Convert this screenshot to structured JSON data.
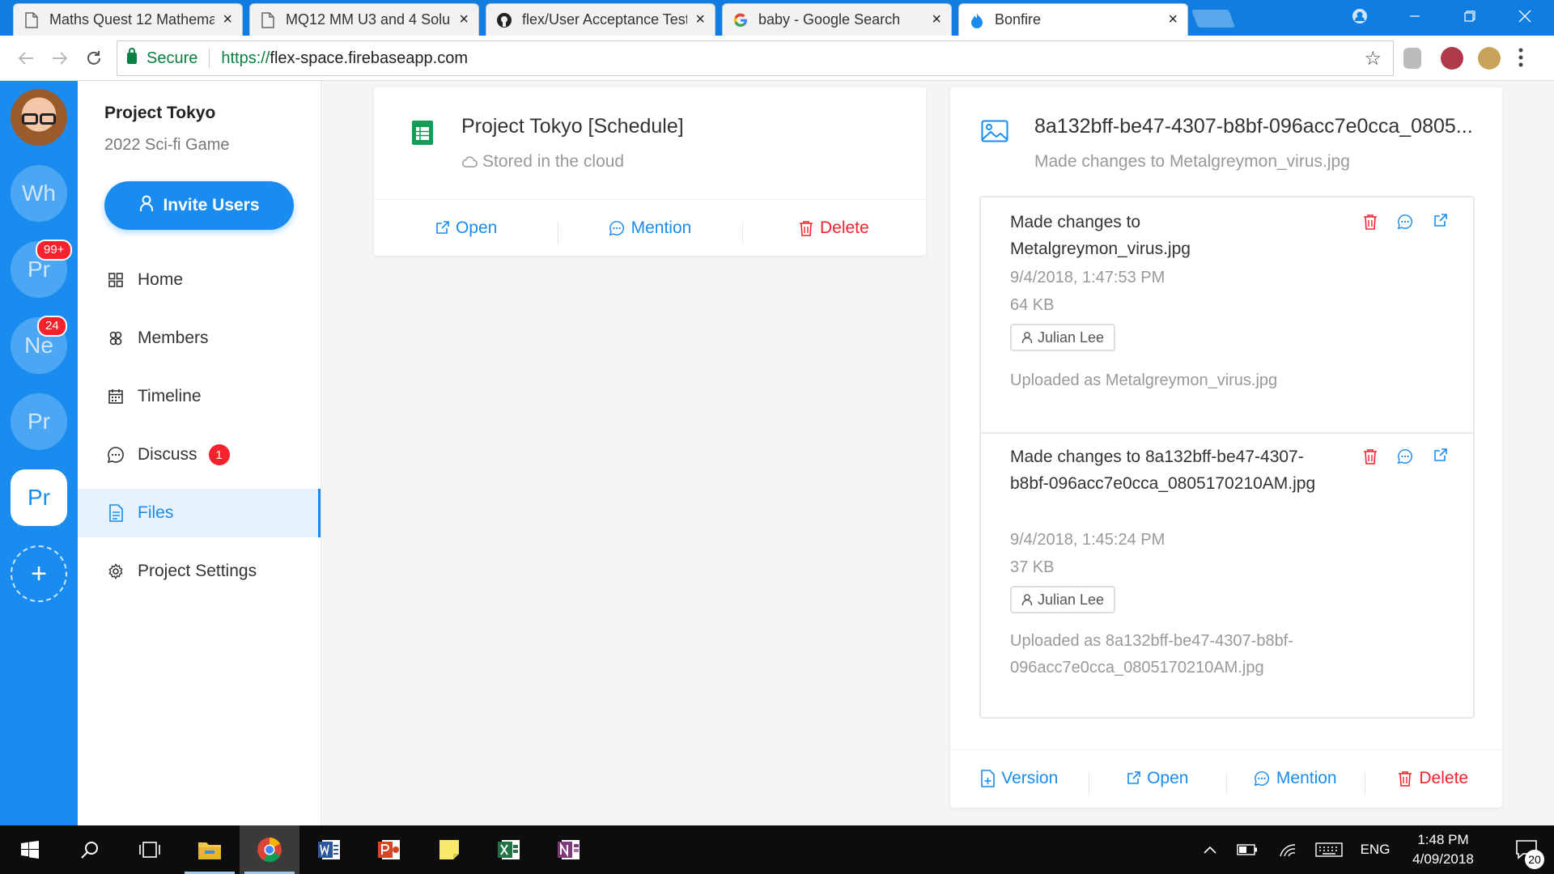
{
  "browser": {
    "tabs": [
      {
        "title": "Maths Quest 12 Mathema",
        "icon": "document-icon"
      },
      {
        "title": "MQ12 MM U3 and 4 Solu",
        "icon": "document-icon"
      },
      {
        "title": "flex/User Acceptance Test",
        "icon": "github-icon"
      },
      {
        "title": "baby - Google Search",
        "icon": "google-icon"
      },
      {
        "title": "Bonfire",
        "icon": "bonfire-icon"
      }
    ],
    "close_glyph": "×",
    "secure_label": "Secure",
    "url_scheme": "https://",
    "url_host": "flex-space.firebaseapp.com"
  },
  "strip": {
    "projects": [
      {
        "label": "Wh",
        "badge": ""
      },
      {
        "label": "Pr",
        "badge": "99+"
      },
      {
        "label": "Ne",
        "badge": "24"
      },
      {
        "label": "Pr",
        "badge": ""
      },
      {
        "label": "Pr",
        "badge": ""
      }
    ],
    "add_label": "+"
  },
  "nav": {
    "project_name": "Project Tokyo",
    "project_desc": "2022 Sci-fi Game",
    "invite_label": "Invite Users",
    "items": [
      {
        "label": "Home",
        "icon": "grid-icon"
      },
      {
        "label": "Members",
        "icon": "members-icon"
      },
      {
        "label": "Timeline",
        "icon": "calendar-icon"
      },
      {
        "label": "Discuss",
        "icon": "chat-icon",
        "badge": "1"
      },
      {
        "label": "Files",
        "icon": "file-icon"
      },
      {
        "label": "Project Settings",
        "icon": "gear-icon"
      }
    ]
  },
  "left_card": {
    "title": "Project Tokyo [Schedule]",
    "subtitle": "Stored in the cloud",
    "actions": {
      "open": "Open",
      "mention": "Mention",
      "delete": "Delete"
    }
  },
  "right_card": {
    "title": "8a132bff-be47-4307-b8bf-096acc7e0cca_0805...",
    "subtitle": "Made changes to Metalgreymon_virus.jpg",
    "history": [
      {
        "heading": "Made changes to Metalgreymon_virus.jpg",
        "date": "9/4/2018, 1:47:53 PM",
        "size": "64 KB",
        "user": "Julian Lee",
        "uploaded": "Uploaded as Metalgreymon_virus.jpg"
      },
      {
        "heading": "Made changes to 8a132bff-be47-4307-b8bf-096acc7e0cca_0805170210AM.jpg",
        "date": "9/4/2018, 1:45:24 PM",
        "size": "37 KB",
        "user": "Julian Lee",
        "uploaded": "Uploaded as 8a132bff-be47-4307-b8bf-096acc7e0cca_0805170210AM.jpg"
      }
    ],
    "actions": {
      "version": "Version",
      "open": "Open",
      "mention": "Mention",
      "delete": "Delete"
    }
  },
  "taskbar": {
    "lang": "ENG",
    "time": "1:48 PM",
    "date": "4/09/2018",
    "notifications": "20"
  },
  "colors": {
    "primary": "#1a8cf0",
    "danger": "#f5222d",
    "sheets_green": "#0f9d58"
  }
}
